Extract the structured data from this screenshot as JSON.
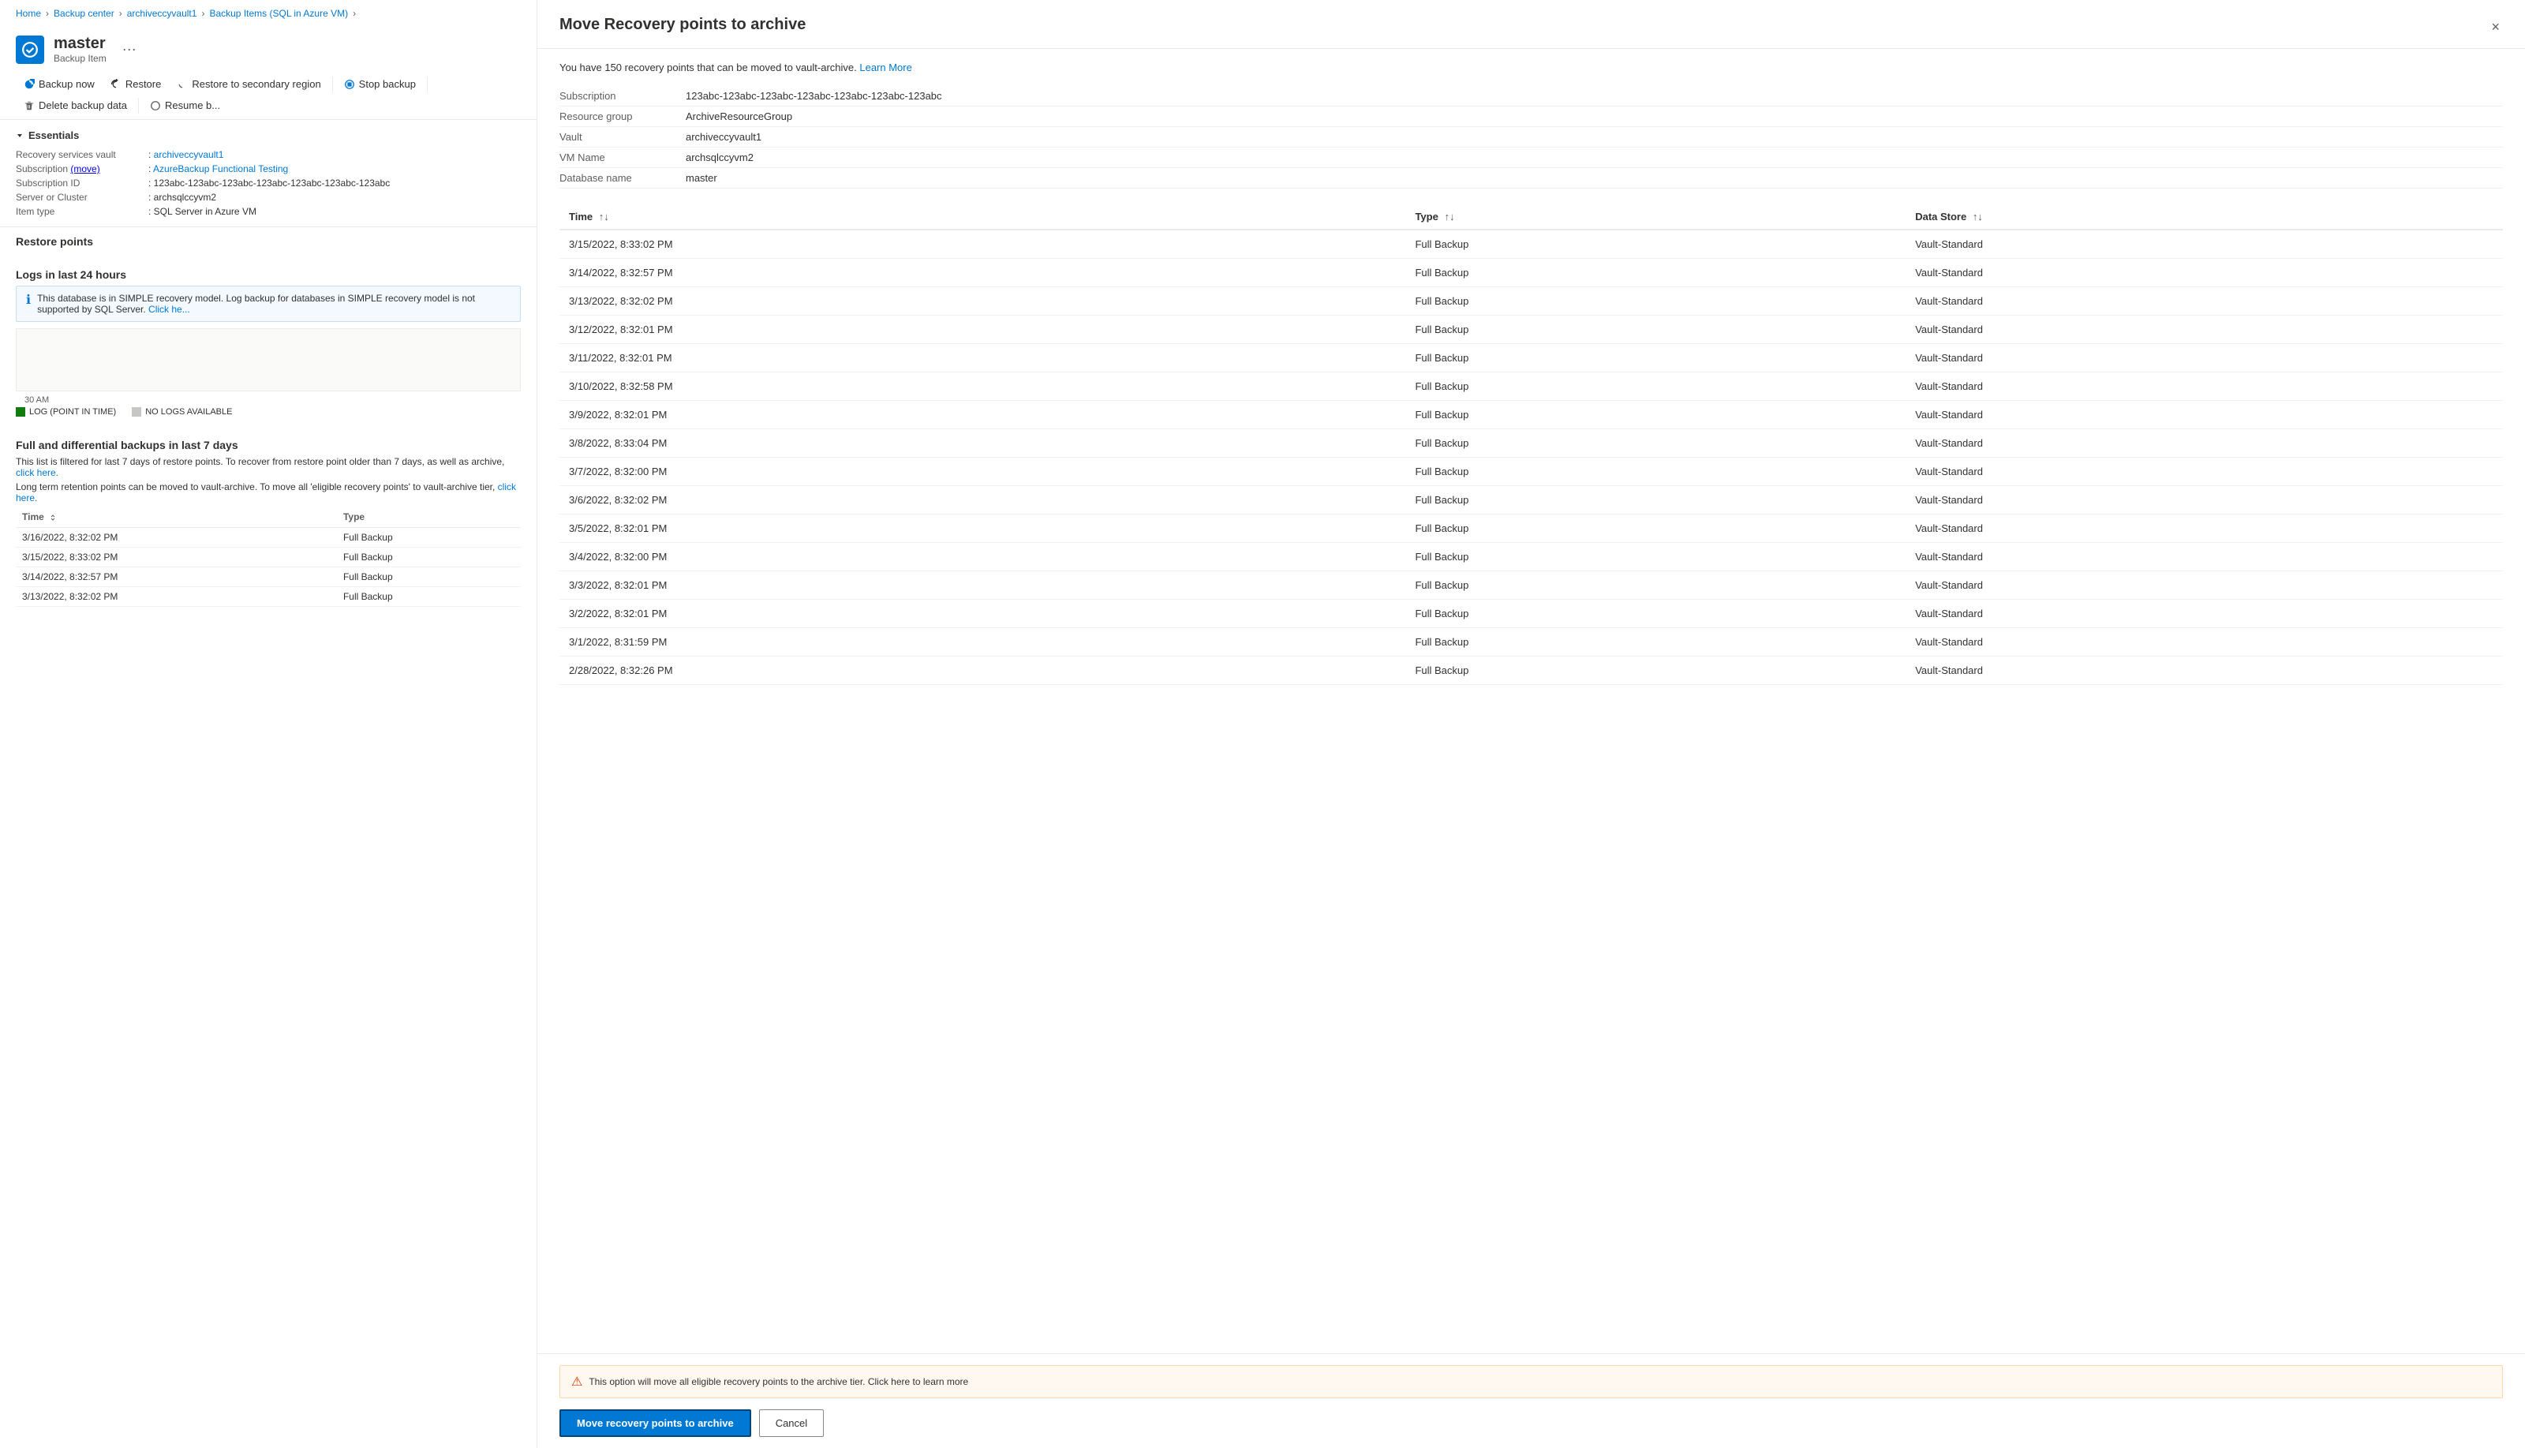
{
  "breadcrumb": {
    "items": [
      "Home",
      "Backup center",
      "archiveccyvault1",
      "Backup Items (SQL in Azure VM)"
    ],
    "separators": [
      ">",
      ">",
      ">"
    ]
  },
  "page": {
    "title": "master",
    "subtitle": "Backup Item",
    "more_icon": "···"
  },
  "toolbar": {
    "buttons": [
      {
        "id": "backup-now",
        "label": "Backup now",
        "icon": "refresh"
      },
      {
        "id": "restore",
        "label": "Restore",
        "icon": "restore"
      },
      {
        "id": "restore-secondary",
        "label": "Restore to secondary region",
        "icon": "restore-secondary"
      },
      {
        "id": "stop-backup",
        "label": "Stop backup",
        "icon": "stop"
      },
      {
        "id": "delete-backup",
        "label": "Delete backup data",
        "icon": "delete"
      },
      {
        "id": "resume-backup",
        "label": "Resume b...",
        "icon": "resume"
      }
    ]
  },
  "essentials": {
    "title": "Essentials",
    "fields": [
      {
        "label": "Recovery services vault",
        "value": "archiveccyvault1",
        "link": true
      },
      {
        "label": "Subscription",
        "value": "AzureBackup Functional Testing",
        "link": true,
        "prefix": "(move)"
      },
      {
        "label": "Subscription ID",
        "value": "123abc-123abc-123abc-123abc-123abc-123abc-123abc"
      },
      {
        "label": "Server or Cluster",
        "value": "archsqlccyvm2"
      },
      {
        "label": "Item type",
        "value": "SQL Server in Azure VM"
      }
    ]
  },
  "restore_points": {
    "title": "Restore points"
  },
  "logs_section": {
    "title": "Logs in last 24 hours",
    "info_message": "This database is in SIMPLE recovery model. Log backup for databases in SIMPLE recovery model is not supported by SQL Server.",
    "info_link": "Click he...",
    "chart_time": "30 AM",
    "legend": [
      {
        "label": "LOG (POINT IN TIME)",
        "color": "#107c10"
      },
      {
        "label": "NO LOGS AVAILABLE",
        "color": "#c8c6c4"
      }
    ]
  },
  "full_diff_section": {
    "title": "Full and differential backups in last 7 days",
    "description1": "This list is filtered for last 7 days of restore points. To recover from restore point older than 7 days, as well as archive,",
    "description1_link": "click here.",
    "description2": "Long term retention points can be moved to vault-archive. To move all 'eligible recovery points' to vault-archive tier,",
    "description2_link": "click here.",
    "columns": [
      "Time",
      "Type"
    ],
    "rows": [
      {
        "time": "3/16/2022, 8:32:02 PM",
        "type": "Full Backup"
      },
      {
        "time": "3/15/2022, 8:33:02 PM",
        "type": "Full Backup"
      },
      {
        "time": "3/14/2022, 8:32:57 PM",
        "type": "Full Backup"
      },
      {
        "time": "3/13/2022, 8:32:02 PM",
        "type": "Full Backup"
      }
    ]
  },
  "panel": {
    "title": "Move Recovery points to archive",
    "intro": "You have 150 recovery points that can be moved to vault-archive.",
    "learn_more": "Learn More",
    "close_label": "×",
    "meta": [
      {
        "label": "Subscription",
        "value": "123abc-123abc-123abc-123abc-123abc-123abc-123abc"
      },
      {
        "label": "Resource group",
        "value": "ArchiveResourceGroup"
      },
      {
        "label": "Vault",
        "value": "archiveccyvault1"
      },
      {
        "label": "VM Name",
        "value": "archsqlccyvm2"
      },
      {
        "label": "Database name",
        "value": "master"
      }
    ],
    "table": {
      "columns": [
        {
          "label": "Time",
          "sortable": true
        },
        {
          "label": "Type",
          "sortable": true
        },
        {
          "label": "Data Store",
          "sortable": true
        }
      ],
      "rows": [
        {
          "time": "3/15/2022, 8:33:02 PM",
          "type": "Full Backup",
          "store": "Vault-Standard"
        },
        {
          "time": "3/14/2022, 8:32:57 PM",
          "type": "Full Backup",
          "store": "Vault-Standard"
        },
        {
          "time": "3/13/2022, 8:32:02 PM",
          "type": "Full Backup",
          "store": "Vault-Standard"
        },
        {
          "time": "3/12/2022, 8:32:01 PM",
          "type": "Full Backup",
          "store": "Vault-Standard"
        },
        {
          "time": "3/11/2022, 8:32:01 PM",
          "type": "Full Backup",
          "store": "Vault-Standard"
        },
        {
          "time": "3/10/2022, 8:32:58 PM",
          "type": "Full Backup",
          "store": "Vault-Standard"
        },
        {
          "time": "3/9/2022, 8:32:01 PM",
          "type": "Full Backup",
          "store": "Vault-Standard"
        },
        {
          "time": "3/8/2022, 8:33:04 PM",
          "type": "Full Backup",
          "store": "Vault-Standard"
        },
        {
          "time": "3/7/2022, 8:32:00 PM",
          "type": "Full Backup",
          "store": "Vault-Standard"
        },
        {
          "time": "3/6/2022, 8:32:02 PM",
          "type": "Full Backup",
          "store": "Vault-Standard"
        },
        {
          "time": "3/5/2022, 8:32:01 PM",
          "type": "Full Backup",
          "store": "Vault-Standard"
        },
        {
          "time": "3/4/2022, 8:32:00 PM",
          "type": "Full Backup",
          "store": "Vault-Standard"
        },
        {
          "time": "3/3/2022, 8:32:01 PM",
          "type": "Full Backup",
          "store": "Vault-Standard"
        },
        {
          "time": "3/2/2022, 8:32:01 PM",
          "type": "Full Backup",
          "store": "Vault-Standard"
        },
        {
          "time": "3/1/2022, 8:31:59 PM",
          "type": "Full Backup",
          "store": "Vault-Standard"
        },
        {
          "time": "2/28/2022, 8:32:26 PM",
          "type": "Full Backup",
          "store": "Vault-Standard"
        }
      ]
    },
    "warning": "This option will move all eligible recovery points to the archive tier. Click here to learn more",
    "buttons": {
      "primary": "Move recovery points to archive",
      "secondary": "Cancel"
    }
  },
  "colors": {
    "primary": "#0078d4",
    "accent": "#004578",
    "success": "#107c10",
    "warning": "#d83b01",
    "border": "#edebe9",
    "bg_light": "#f3f2f1"
  }
}
